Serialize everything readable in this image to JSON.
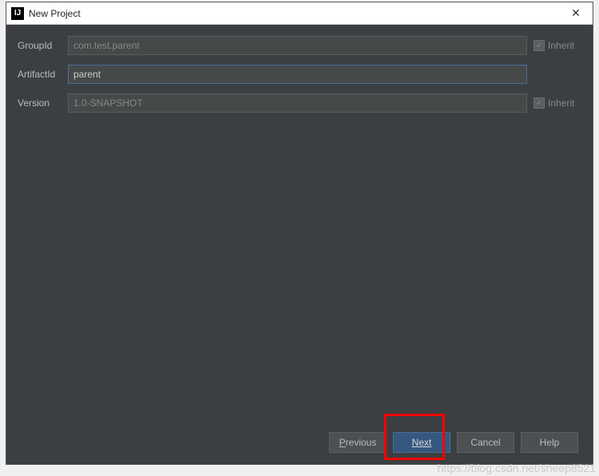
{
  "titlebar": {
    "app_icon_glyph": "IJ",
    "title": "New Project",
    "close_glyph": "✕"
  },
  "form": {
    "groupId": {
      "label": "GroupId",
      "value": "com.test.parent",
      "inherit_label": "Inherit"
    },
    "artifactId": {
      "label": "ArtifactId",
      "value": "parent"
    },
    "version": {
      "label": "Version",
      "value": "1.0-SNAPSHOT",
      "inherit_label": "Inherit"
    }
  },
  "buttons": {
    "previous": "Previous",
    "next": "Next",
    "cancel": "Cancel",
    "help": "Help"
  },
  "watermark": "https://blog.csdn.net/sheep8521"
}
